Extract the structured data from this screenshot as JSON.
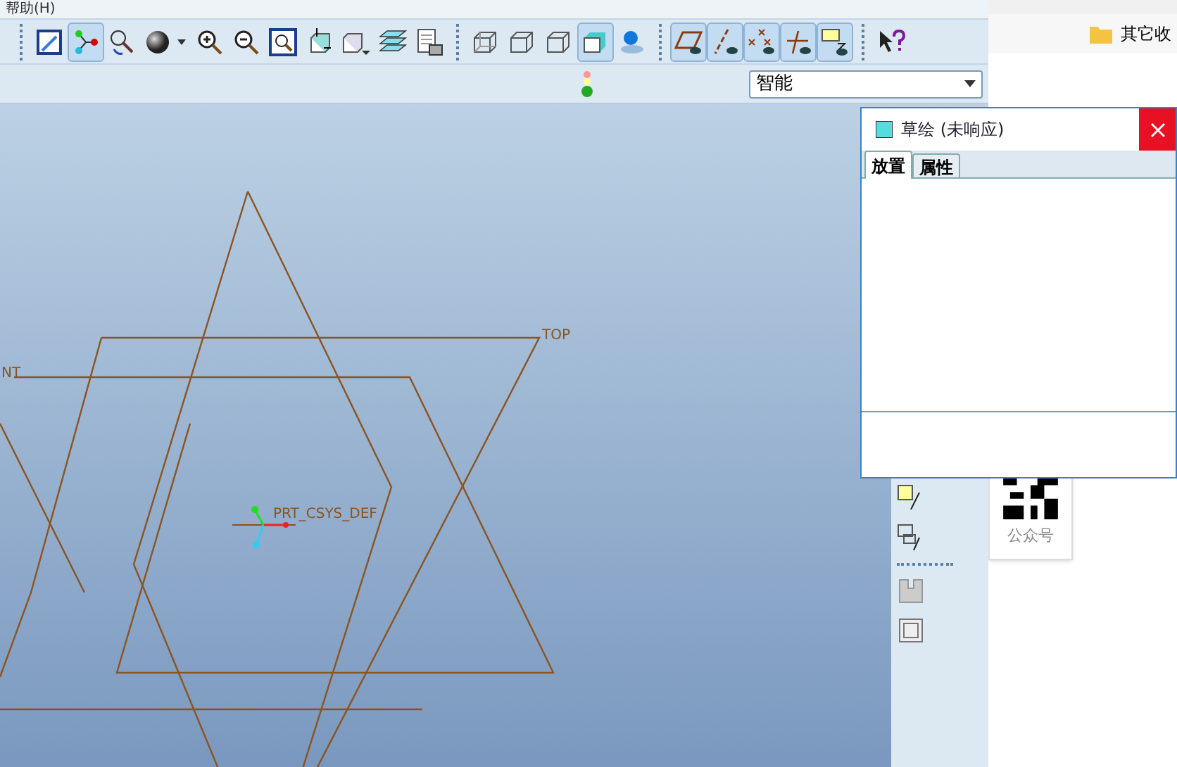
{
  "menu": {
    "label": "帮助(H)"
  },
  "toolbar": [
    {
      "kind": "sketch",
      "pressed": false
    },
    {
      "kind": "points",
      "pressed": true
    },
    {
      "kind": "spin",
      "pressed": false
    },
    {
      "kind": "sphere",
      "pressed": false
    },
    {
      "kind": "zoom-in",
      "pressed": false
    },
    {
      "kind": "zoom-out",
      "pressed": false
    },
    {
      "kind": "fit",
      "pressed": false
    },
    {
      "kind": "orient",
      "pressed": false
    },
    {
      "kind": "views",
      "pressed": false
    },
    {
      "kind": "layers",
      "pressed": false
    },
    {
      "kind": "sheet",
      "pressed": false
    },
    {
      "kind": "wire",
      "pressed": false
    },
    {
      "kind": "hidden",
      "pressed": false
    },
    {
      "kind": "nohidden",
      "pressed": false
    },
    {
      "kind": "shaded",
      "pressed": true
    },
    {
      "kind": "pin",
      "pressed": false
    },
    {
      "kind": "plane",
      "pressed": true
    },
    {
      "kind": "axis",
      "pressed": true
    },
    {
      "kind": "point",
      "pressed": true
    },
    {
      "kind": "csys",
      "pressed": true
    },
    {
      "kind": "note",
      "pressed": true
    },
    {
      "kind": "help",
      "pressed": false
    }
  ],
  "filter": {
    "value": "智能"
  },
  "canvas": {
    "labels": [
      "TOP",
      "NT",
      "PRT_CSYS_DEF"
    ]
  },
  "dialog": {
    "title": "草绘 (未响应)",
    "tabs": [
      {
        "label": "放置",
        "selected": true
      },
      {
        "label": "属性",
        "selected": false
      }
    ]
  },
  "browser": {
    "bookmark": "其它收",
    "card_caption": "公众号"
  }
}
